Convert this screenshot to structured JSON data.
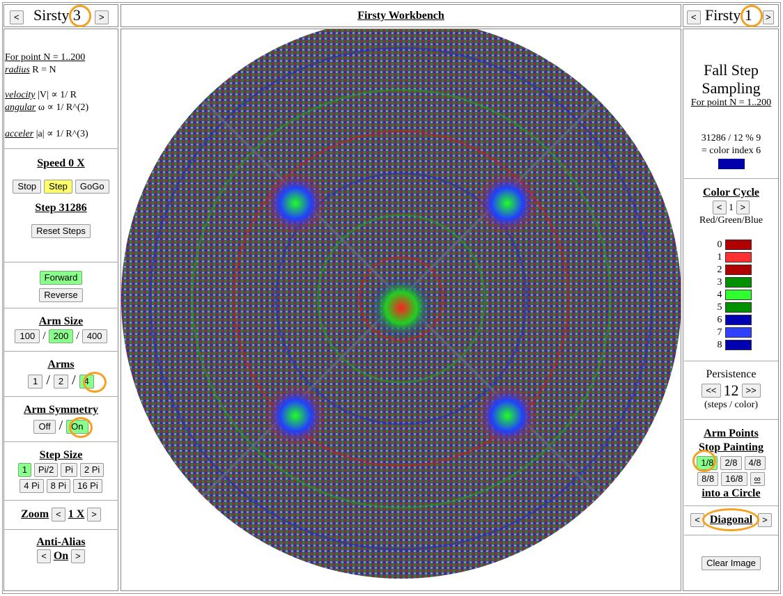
{
  "left_header": {
    "prev": "<",
    "title": "Sirsty",
    "num": "3",
    "next": ">"
  },
  "center_header": {
    "title": "Firsty Workbench"
  },
  "right_header": {
    "prev": "<",
    "title": "Firsty",
    "num": "1",
    "next": ">"
  },
  "formula": {
    "line1": "For point N = 1..200",
    "radius_label": "radius",
    "radius_rest": " R = N",
    "velocity_label": "velocity",
    "velocity_rest": " |V| ∝ 1/ R",
    "angular_label": "angular",
    "angular_rest": " ω ∝ 1/ R^(2)",
    "acceler_label": "acceler",
    "acceler_rest": " |a| ∝ 1/ R^(3)"
  },
  "speed": {
    "title": "Speed 0 X",
    "stop": "Stop",
    "step": "Step",
    "gogo": "GoGo",
    "step_count": "Step 31286",
    "reset": "Reset Steps"
  },
  "direction": {
    "forward": "Forward",
    "reverse": "Reverse"
  },
  "arm_size": {
    "title": "Arm Size",
    "opt1": "100",
    "opt2": "200",
    "opt3": "400",
    "sep": "/"
  },
  "arms": {
    "title": "Arms",
    "opt1": "1",
    "opt2": "2",
    "opt3": "4",
    "sep": "/"
  },
  "arm_symmetry": {
    "title": "Arm Symmetry",
    "off": "Off",
    "on": "On",
    "sep": "/"
  },
  "step_size": {
    "title": "Step Size",
    "opts": [
      "1",
      "Pi/2",
      "Pi",
      "2 Pi",
      "4 Pi",
      "8 Pi",
      "16 Pi"
    ]
  },
  "zoom": {
    "title": "Zoom",
    "prev": "<",
    "value": "1 X",
    "next": ">"
  },
  "anti_alias": {
    "title": "Anti-Alias",
    "prev": "<",
    "value": "On",
    "next": ">"
  },
  "sampling": {
    "title1": "Fall Step",
    "title2": "Sampling",
    "sub": "For point N = 1..200",
    "calc1": "31286 / 12 % 9",
    "calc2": "= color index 6",
    "current_color": "#0000aa"
  },
  "color_cycle": {
    "title": "Color Cycle",
    "prev": "<",
    "value": "1",
    "next": ">",
    "desc": "Red/Green/Blue"
  },
  "palette": [
    {
      "idx": "0",
      "color": "#b00000"
    },
    {
      "idx": "1",
      "color": "#ff3030"
    },
    {
      "idx": "2",
      "color": "#b00000"
    },
    {
      "idx": "3",
      "color": "#009000"
    },
    {
      "idx": "4",
      "color": "#30ff30"
    },
    {
      "idx": "5",
      "color": "#009000"
    },
    {
      "idx": "6",
      "color": "#0000b0"
    },
    {
      "idx": "7",
      "color": "#3040ff"
    },
    {
      "idx": "8",
      "color": "#0000b0"
    }
  ],
  "persistence": {
    "title": "Persistence",
    "prev": "<<",
    "value": "12",
    "next": ">>",
    "desc": "(steps / color)"
  },
  "arm_points": {
    "title1": "Arm Points",
    "title2": "Stop Painting",
    "opts": [
      "1/8",
      "2/8",
      "4/8",
      "8/8",
      "16/8",
      "∞"
    ],
    "title3": "into a Circle"
  },
  "pattern": {
    "prev": "<",
    "value": "Diagonal",
    "next": ">"
  },
  "clear": {
    "label": "Clear Image"
  }
}
